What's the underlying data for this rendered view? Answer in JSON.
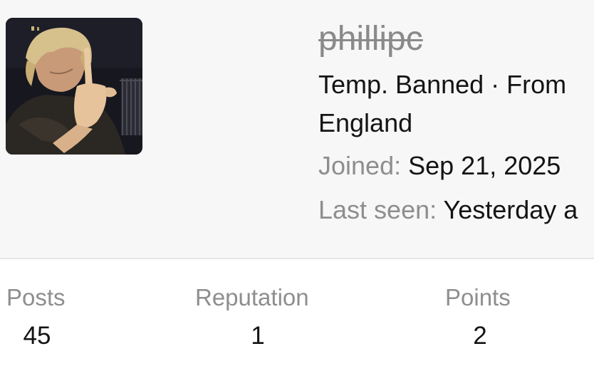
{
  "profile": {
    "username": "phillipc",
    "status": "Temp. Banned · From England",
    "joined_label": "Joined:",
    "joined_value": "Sep 21, 2025",
    "last_seen_label": "Last seen:",
    "last_seen_value": "Yesterday a"
  },
  "stats": [
    {
      "label": "Posts",
      "value": "45"
    },
    {
      "label": "Reputation",
      "value": "1"
    },
    {
      "label": "Points",
      "value": "2"
    }
  ]
}
